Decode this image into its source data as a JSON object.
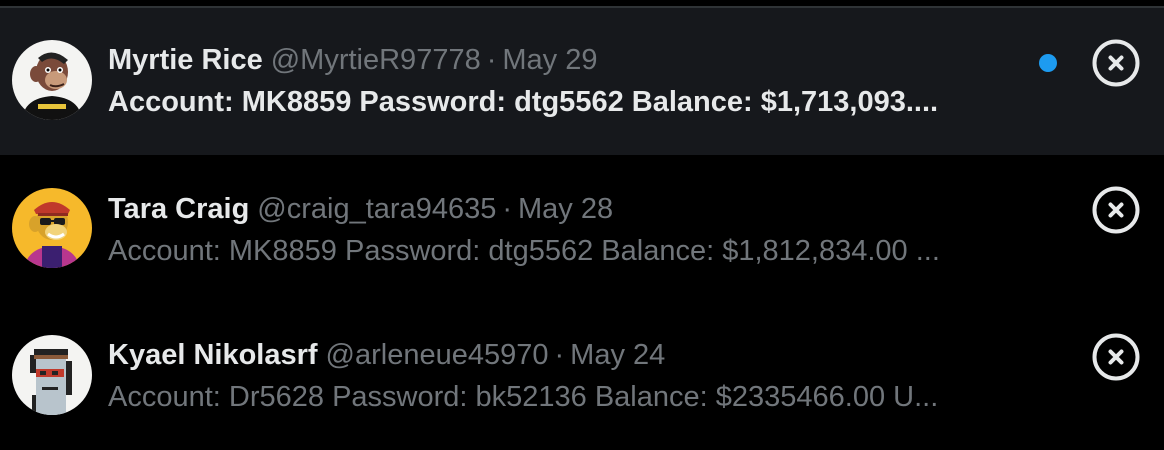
{
  "colors": {
    "background": "#000000",
    "selected_row": "#16181c",
    "primary_text": "#e7e9ea",
    "secondary_text": "#71767b",
    "unread_dot": "#1d9bf0",
    "divider": "#2f3336"
  },
  "conversations": [
    {
      "name": "Myrtie Rice",
      "handle": "@MyrtieR97778",
      "separator": "·",
      "date": "May 29",
      "preview": "Account: MK8859 Password: dtg5562 Balance: $1,713,093....",
      "unread": true,
      "avatar_icon": "ape-avatar-icon",
      "close_icon": "close-circle-icon"
    },
    {
      "name": "Tara Craig",
      "handle": "@craig_tara94635",
      "separator": "·",
      "date": "May 28",
      "preview": "Account: MK8859 Password: dtg5562 Balance: $1,812,834.00 ...",
      "unread": false,
      "avatar_icon": "ape-avatar-icon",
      "close_icon": "close-circle-icon"
    },
    {
      "name": "Kyael Nikolasrf",
      "handle": "@arleneue45970",
      "separator": "·",
      "date": "May 24",
      "preview": "Account: Dr5628 Password: bk52136 Balance: $2335466.00 U...",
      "unread": false,
      "avatar_icon": "pixel-punk-avatar-icon",
      "close_icon": "close-circle-icon"
    }
  ]
}
